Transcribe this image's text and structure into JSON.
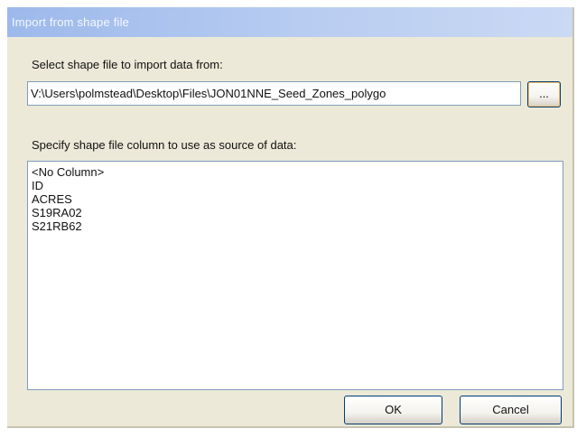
{
  "window": {
    "title": "Import from shape file"
  },
  "file_section": {
    "label": "Select shape file to import data from:",
    "path_value": "V:\\Users\\polmstead\\Desktop\\Files\\JON01NNE_Seed_Zones_polygo",
    "browse_label": "..."
  },
  "column_section": {
    "label": "Specify shape file column to use as source of data:",
    "items": [
      "<No Column>",
      "ID",
      "ACRES",
      "S19RA02",
      "S21RB62"
    ]
  },
  "buttons": {
    "ok_label": "OK",
    "cancel_label": "Cancel"
  }
}
